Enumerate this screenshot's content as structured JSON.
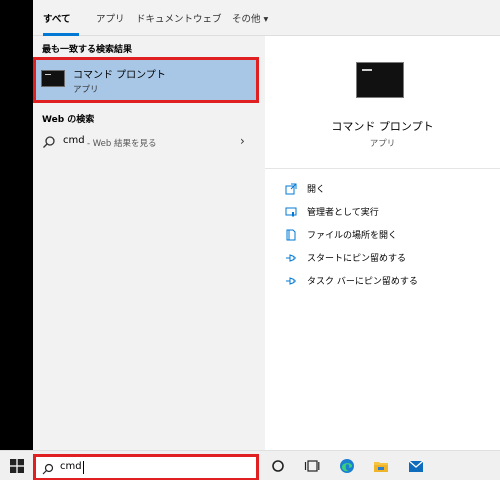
{
  "tabs": [
    {
      "label": "すべて",
      "active": true
    },
    {
      "label": "アプリ",
      "active": false
    },
    {
      "label": "ドキュメント",
      "active": false
    },
    {
      "label": "ウェブ",
      "active": false
    },
    {
      "label": "その他 ▾",
      "active": false
    }
  ],
  "best_match": {
    "header": "最も一致する検索結果",
    "title": "コマンド プロンプト",
    "subtitle": "アプリ"
  },
  "web": {
    "header": "Web の検索",
    "query": "cmd",
    "hint": "- Web 結果を見る",
    "chevron": "›"
  },
  "details": {
    "app_name": "コマンド プロンプト",
    "app_type": "アプリ",
    "actions": [
      {
        "label": "開く",
        "icon": "open-icon"
      },
      {
        "label": "管理者として実行",
        "icon": "run-as-admin-icon"
      },
      {
        "label": "ファイルの場所を開く",
        "icon": "file-location-icon"
      },
      {
        "label": "スタートにピン留めする",
        "icon": "pin-icon"
      },
      {
        "label": "タスク バーにピン留めする",
        "icon": "pin-icon"
      }
    ]
  },
  "taskbar": {
    "search_value": "cmd",
    "icons": [
      "windows-start-icon",
      "search-icon",
      "cortana-icon",
      "task-view-icon",
      "edge-icon",
      "file-explorer-icon",
      "mail-icon"
    ]
  },
  "colors": {
    "accent": "#0078d4",
    "highlight": "#a8c7e6",
    "annotation": "#e02020"
  }
}
